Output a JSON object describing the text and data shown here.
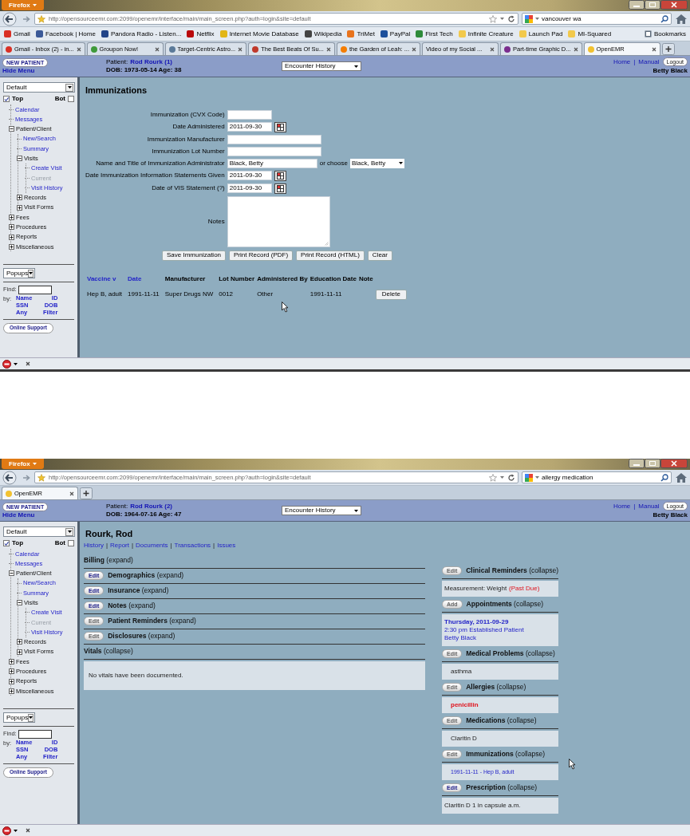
{
  "screenshots": [
    {
      "browser": {
        "menu_button": "Firefox",
        "url": "http://opensourceemr.com:2099/openemr/interface/main/main_screen.php?auth=login&site=default",
        "search": "vancouver wa",
        "bookmarks": [
          {
            "label": "Gmail",
            "color": "#d93025"
          },
          {
            "label": "Facebook | Home",
            "color": "#3b5998"
          },
          {
            "label": "Pandora Radio - Listen...",
            "color": "#224488"
          },
          {
            "label": "Netflix",
            "color": "#b9090b"
          },
          {
            "label": "Internet Movie Database",
            "color": "#e2b616"
          },
          {
            "label": "Wikipedia",
            "color": "#444444"
          },
          {
            "label": "TriMet",
            "color": "#e8731c"
          },
          {
            "label": "PayPal",
            "color": "#1c4f9c"
          },
          {
            "label": "First Tech",
            "color": "#2e8b3a"
          },
          {
            "label": "Infinite Creature",
            "color": "#f2c94c"
          },
          {
            "label": "Launch Pad",
            "color": "#f2c94c"
          },
          {
            "label": "MI-Squared",
            "color": "#f2c94c"
          }
        ],
        "bookmarks_menu": "Bookmarks",
        "tabs": [
          {
            "label": "Gmail - Inbox (2) - in...",
            "color": "#d93025",
            "selected": false
          },
          {
            "label": "Groupon Now!",
            "color": "#3f9a3a",
            "selected": false
          },
          {
            "label": "Target-Centric Astro...",
            "color": "#5b7a99",
            "selected": false
          },
          {
            "label": "The Best Beats Of Su...",
            "color": "#c0392b",
            "selected": false
          },
          {
            "label": "the Garden of Leah: ...",
            "color": "#f57d00",
            "selected": false
          },
          {
            "label": "Video of my Social ...",
            "selected": false
          },
          {
            "label": "Part-time Graphic D...",
            "color": "#7b2d8e",
            "selected": false
          },
          {
            "label": "OpenEMR",
            "color": "#f2c230",
            "selected": true
          }
        ]
      },
      "header": {
        "new_patient": "NEW PATIENT",
        "hide_menu": "Hide Menu",
        "patient_label": "Patient:",
        "patient_name": "Rod Rourk (1)",
        "dob": "DOB: 1973-05-14 Age: 38",
        "encounter_select": "Encounter History",
        "home": "Home",
        "separator": "|",
        "manual": "Manual",
        "logout": "Logout",
        "user": "Betty Black"
      },
      "sidebar": {
        "view_select": "Default",
        "top": {
          "label": "Top",
          "checked": true
        },
        "bot": {
          "label": "Bot",
          "checked": false
        },
        "tree": [
          {
            "label": "Calendar",
            "kind": "link",
            "disabled": false
          },
          {
            "label": "Messages",
            "kind": "link",
            "disabled": false
          },
          {
            "label": "Patient/Client",
            "kind": "folder",
            "expanded": true,
            "children": [
              {
                "label": "New/Search",
                "kind": "link",
                "disabled": false
              },
              {
                "label": "Summary",
                "kind": "link",
                "disabled": false
              },
              {
                "label": "Visits",
                "kind": "folder",
                "expanded": true,
                "children": [
                  {
                    "label": "Create Visit",
                    "kind": "link",
                    "disabled": false
                  },
                  {
                    "label": "Current",
                    "kind": "link",
                    "disabled": true
                  },
                  {
                    "label": "Visit History",
                    "kind": "link",
                    "disabled": false
                  }
                ]
              },
              {
                "label": "Records",
                "kind": "folder",
                "expanded": false
              },
              {
                "label": "Visit Forms",
                "kind": "folder",
                "expanded": false
              }
            ]
          },
          {
            "label": "Fees",
            "kind": "folder",
            "expanded": false
          },
          {
            "label": "Procedures",
            "kind": "folder",
            "expanded": false
          },
          {
            "label": "Reports",
            "kind": "folder",
            "expanded": false
          },
          {
            "label": "Miscellaneous",
            "kind": "folder",
            "expanded": false
          }
        ],
        "popups_select": "Popups",
        "find_label": "Find:",
        "by_label": "by:",
        "find_links": [
          "Name",
          "ID",
          "SSN",
          "DOB",
          "Any",
          "Filter"
        ],
        "online_support": "Online Support"
      },
      "main": {
        "kind": "immunizations",
        "title": "Immunizations",
        "fields": [
          {
            "label": "Immunization (CVX Code)",
            "kind": "short_text"
          },
          {
            "label": "Date Administered",
            "kind": "date",
            "value": "2011-09-30"
          },
          {
            "label": "Immunization Manufacturer",
            "kind": "text"
          },
          {
            "label": "Immunization Lot Number",
            "kind": "text"
          },
          {
            "label": "Name and Title of Immunization Administrator",
            "kind": "text_choose",
            "value": "Black, Betty",
            "choose_label": "or choose",
            "choose_value": "Black, Betty"
          },
          {
            "label": "Date Immunization Information Statements Given",
            "kind": "date",
            "value": "2011-09-30"
          },
          {
            "label": "Date of VIS Statement (?)",
            "kind": "date",
            "value": "2011-09-30"
          },
          {
            "label": "Notes",
            "kind": "textarea"
          }
        ],
        "buttons": [
          "Save Immunization",
          "Print Record (PDF)",
          "Print Record (HTML)",
          "Clear"
        ],
        "table": {
          "columns": [
            {
              "label": "Vaccine v",
              "sortable": true
            },
            {
              "label": "Date",
              "sortable": true
            },
            {
              "label": "Manufacturer",
              "sortable": false
            },
            {
              "label": "Lot Number",
              "sortable": false
            },
            {
              "label": "Administered By",
              "sortable": false
            },
            {
              "label": "Education Date",
              "sortable": false
            },
            {
              "label": "Note",
              "sortable": false
            }
          ],
          "rows": [
            {
              "cells": [
                "Hep B, adult",
                "1991-11-11",
                "Super Drugs NW",
                "0012",
                "Other",
                "1991-11-11"
              ],
              "action": "Delete"
            }
          ]
        }
      }
    },
    {
      "browser": {
        "menu_button": "Firefox",
        "url": "http://opensourceemr.com:2099/openemr/interface/main/main_screen.php?auth=login&site=default",
        "search": "allergy medication",
        "tabs": [
          {
            "label": "OpenEMR",
            "color": "#f2c230",
            "selected": true
          }
        ]
      },
      "header": {
        "new_patient": "NEW PATIENT",
        "hide_menu": "Hide Menu",
        "patient_label": "Patient:",
        "patient_name": "Rod Rourk (2)",
        "dob": "DOB: 1964-07-16 Age: 47",
        "encounter_select": "Encounter History",
        "home": "Home",
        "separator": "|",
        "manual": "Manual",
        "logout": "Logout",
        "user": "Betty Black"
      },
      "sidebar": {
        "view_select": "Default",
        "top": {
          "label": "Top",
          "checked": true
        },
        "bot": {
          "label": "Bot",
          "checked": false
        },
        "tree": [
          {
            "label": "Calendar",
            "kind": "link",
            "disabled": false
          },
          {
            "label": "Messages",
            "kind": "link",
            "disabled": false
          },
          {
            "label": "Patient/Client",
            "kind": "folder",
            "expanded": true,
            "children": [
              {
                "label": "New/Search",
                "kind": "link",
                "disabled": false
              },
              {
                "label": "Summary",
                "kind": "link",
                "disabled": false
              },
              {
                "label": "Visits",
                "kind": "folder",
                "expanded": true,
                "children": [
                  {
                    "label": "Create Visit",
                    "kind": "link",
                    "disabled": false
                  },
                  {
                    "label": "Current",
                    "kind": "link",
                    "disabled": true
                  },
                  {
                    "label": "Visit History",
                    "kind": "link",
                    "disabled": false
                  }
                ]
              },
              {
                "label": "Records",
                "kind": "folder",
                "expanded": false
              },
              {
                "label": "Visit Forms",
                "kind": "folder",
                "expanded": false
              }
            ]
          },
          {
            "label": "Fees",
            "kind": "folder",
            "expanded": false
          },
          {
            "label": "Procedures",
            "kind": "folder",
            "expanded": false
          },
          {
            "label": "Reports",
            "kind": "folder",
            "expanded": false
          },
          {
            "label": "Miscellaneous",
            "kind": "folder",
            "expanded": false
          }
        ],
        "popups_select": "Popups",
        "find_label": "Find:",
        "by_label": "by:",
        "find_links": [
          "Name",
          "ID",
          "SSN",
          "DOB",
          "Any",
          "Filter"
        ],
        "online_support": "Online Support"
      },
      "main": {
        "kind": "summary",
        "title": "Rourk, Rod",
        "nav": [
          "History",
          "Report",
          "Documents",
          "Transactions",
          "Issues"
        ],
        "nav_separator": "|",
        "left_sections": [
          {
            "title": "Billing",
            "toggle": "(expand)"
          },
          {
            "title": "Demographics",
            "toggle": "(expand)",
            "button": {
              "label": "Edit",
              "disabled": false
            }
          },
          {
            "title": "Insurance",
            "toggle": "(expand)",
            "button": {
              "label": "Edit",
              "disabled": false
            }
          },
          {
            "title": "Notes",
            "toggle": "(expand)",
            "button": {
              "label": "Edit",
              "disabled": false
            }
          },
          {
            "title": "Patient Reminders",
            "toggle": "(expand)",
            "button": {
              "label": "Edit",
              "disabled": true
            }
          },
          {
            "title": "Disclosures",
            "toggle": "(expand)",
            "button": {
              "label": "Edit",
              "disabled": true
            }
          },
          {
            "title": "Vitals",
            "toggle": "(collapse)",
            "lines": [
              {
                "text": "No vitals have been documented.",
                "kind": "plain"
              }
            ]
          }
        ],
        "right_sections": [
          {
            "title": "Clinical Reminders",
            "toggle": "(collapse)",
            "button": {
              "label": "Edit",
              "disabled": true
            },
            "lines": [
              {
                "text": "Measurement: Weight",
                "kind": "plain",
                "flag": "(Past Due)"
              }
            ]
          },
          {
            "title": "Appointments",
            "toggle": "(collapse)",
            "button": {
              "label": "Add",
              "disabled": true
            },
            "lines": [
              {
                "text": "Thursday, 2011-09-29",
                "kind": "link_bold"
              },
              {
                "text": "2:30 pm Established Patient",
                "kind": "link"
              },
              {
                "text": "Betty Black",
                "kind": "link"
              }
            ]
          },
          {
            "title": "Medical Problems",
            "toggle": "(collapse)",
            "button": {
              "label": "Edit",
              "disabled": true
            },
            "lines": [
              {
                "text": "asthma",
                "kind": "item"
              }
            ]
          },
          {
            "title": "Allergies",
            "toggle": "(collapse)",
            "button": {
              "label": "Edit",
              "disabled": true
            },
            "lines": [
              {
                "text": "penicillin",
                "kind": "alert"
              }
            ]
          },
          {
            "title": "Medications",
            "toggle": "(collapse)",
            "button": {
              "label": "Edit",
              "disabled": true
            },
            "lines": [
              {
                "text": "Claritin D",
                "kind": "item"
              }
            ]
          },
          {
            "title": "Immunizations",
            "toggle": "(collapse)",
            "button": {
              "label": "Edit",
              "disabled": true
            },
            "lines": [
              {
                "text": "1991-11-11 - Hep B, adult",
                "kind": "small_link"
              }
            ]
          },
          {
            "title": "Prescription",
            "toggle": "(collapse)",
            "button": {
              "label": "Edit",
              "disabled": false
            },
            "lines": [
              {
                "text": "Claritin D 1 in capsule a.m.",
                "kind": "plain"
              }
            ]
          }
        ]
      }
    }
  ]
}
